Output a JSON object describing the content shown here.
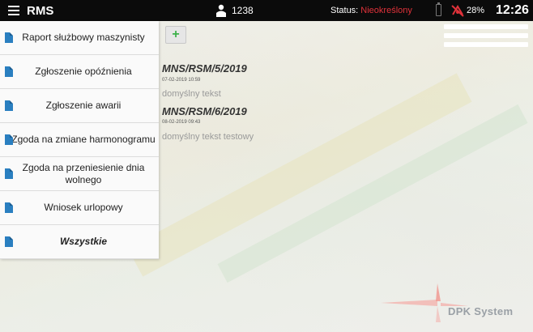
{
  "topbar": {
    "app_title": "RMS",
    "user_id": "1238",
    "status_label": "Status: ",
    "status_value": "Nieokreślony",
    "battery_pct": "28%",
    "clock": "12:26"
  },
  "sidebar": {
    "items": [
      {
        "label": "Raport służbowy maszynisty"
      },
      {
        "label": "Zgłoszenie opóźnienia"
      },
      {
        "label": "Zgłoszenie awarii"
      },
      {
        "label": "Zgoda na zmiane harmonogramu"
      },
      {
        "label": "Zgoda na przeniesienie dnia wolnego"
      },
      {
        "label": "Wniosek urlopowy"
      },
      {
        "label": "Wszystkie"
      }
    ]
  },
  "toolbar": {
    "add_label": "+"
  },
  "entries": [
    {
      "title": "MNS/RSM/5/2019",
      "date": "07-02-2019 10:59",
      "text": "domyślny tekst"
    },
    {
      "title": "MNS/RSM/6/2019",
      "date": "08-02-2019 09:43",
      "text": "domyślny tekst testowy"
    }
  ],
  "logo": {
    "text": "DPK System"
  },
  "colors": {
    "status_value": "#e0323a",
    "add_icon": "#3db14a",
    "doc_icon": "#2a7fc0"
  }
}
